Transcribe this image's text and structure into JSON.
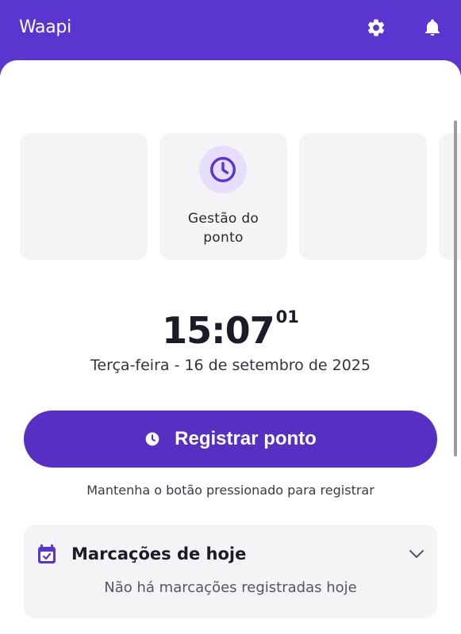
{
  "header": {
    "app_title": "Waapi",
    "icons": [
      "gear-icon",
      "bell-icon"
    ]
  },
  "shortcuts": {
    "cards": [
      {
        "label": ""
      },
      {
        "label": "Gestão do\nponto",
        "icon": "clock-icon"
      },
      {
        "label": ""
      },
      {
        "label": ""
      }
    ]
  },
  "clock": {
    "time": "15:07",
    "seconds": "01",
    "date": "Terça-feira - 16 de setembro de 2025"
  },
  "register": {
    "button_label": "Registrar ponto",
    "hint": "Mantenha o botão pressionado para registrar"
  },
  "today": {
    "title": "Marcações de hoje",
    "empty_message": "Não há marcações registradas hoje"
  },
  "colors": {
    "brand": "#5a35d0",
    "button": "#5530c2",
    "card_bg": "#f4f4f6",
    "icon_circle": "#e7defb"
  }
}
